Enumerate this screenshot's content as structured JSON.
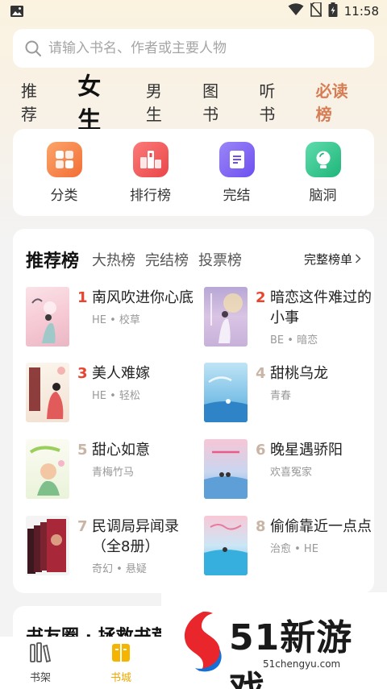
{
  "status_bar": {
    "time": "11:58"
  },
  "search": {
    "placeholder": "请输入书名、作者或主要人物"
  },
  "channel_tabs": [
    {
      "label": "推荐"
    },
    {
      "label": "女生"
    },
    {
      "label": "男生"
    },
    {
      "label": "图书"
    },
    {
      "label": "听书"
    },
    {
      "label": "必读榜"
    }
  ],
  "categories": [
    {
      "label": "分类",
      "icon": "grid-icon",
      "color": "#f7894a"
    },
    {
      "label": "排行榜",
      "icon": "ranking-icon",
      "color": "#f0595c"
    },
    {
      "label": "完结",
      "icon": "document-icon",
      "color": "#7f63f0"
    },
    {
      "label": "脑洞",
      "icon": "bulb-icon",
      "color": "#2fc48a"
    }
  ],
  "ranking": {
    "tabs": [
      {
        "label": "推荐榜"
      },
      {
        "label": "大热榜"
      },
      {
        "label": "完结榜"
      },
      {
        "label": "投票榜"
      }
    ],
    "more": "完整榜单",
    "books": [
      {
        "rank": "1",
        "title": "南风吹进你心底",
        "tags": "HE • 校草"
      },
      {
        "rank": "2",
        "title": "暗恋这件难过的小事",
        "tags": "BE • 暗恋"
      },
      {
        "rank": "3",
        "title": "美人难嫁",
        "tags": "HE • 轻松"
      },
      {
        "rank": "4",
        "title": "甜桃乌龙",
        "tags": "青春"
      },
      {
        "rank": "5",
        "title": "甜心如意",
        "tags": "青梅竹马"
      },
      {
        "rank": "6",
        "title": "晚星遇骄阳",
        "tags": "欢喜冤家"
      },
      {
        "rank": "7",
        "title": "民调局异闻录（全8册）",
        "tags": "奇幻 • 悬疑"
      },
      {
        "rank": "8",
        "title": "偷偷靠近一点点",
        "tags": "治愈 • HE"
      }
    ]
  },
  "peek_card": {
    "title": "书友圈 · 拯救书荒"
  },
  "bottom_nav": [
    {
      "label": "书架"
    },
    {
      "label": "书城"
    }
  ],
  "watermark": {
    "brand": "51新游戏",
    "url": "51chengyu.com"
  }
}
